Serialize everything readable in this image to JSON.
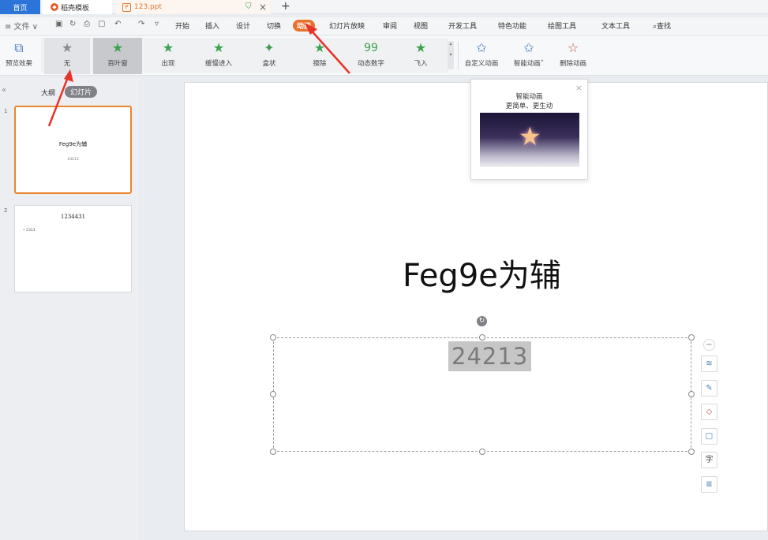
{
  "tabs": {
    "home": "首页",
    "template": "稻壳模板",
    "file": "123.ppt",
    "close": "×",
    "add": "+"
  },
  "quick_access": {
    "menu": "≡ 文件 ∨",
    "icons": [
      "save-icon",
      "undo-icon",
      "print-icon",
      "preview-icon",
      "redo-icon"
    ]
  },
  "menu": {
    "items": [
      "开始",
      "插入",
      "设计",
      "切换",
      "动画",
      "幻灯片放映",
      "审阅",
      "视图",
      "开发工具",
      "特色功能",
      "绘图工具",
      "文本工具"
    ],
    "active": "动画",
    "search": "查找"
  },
  "ribbon": {
    "preview": "预览效果",
    "effects": [
      "无",
      "百叶窗",
      "出现",
      "缓慢进入",
      "盒状",
      "擦除",
      "动态数字",
      "飞入"
    ],
    "custom": "自定义动画",
    "smart": "智能动画",
    "delete": "删除动画"
  },
  "panel": {
    "outline": "大纲",
    "slides": "幻灯片",
    "thumb1_num": "1",
    "thumb1_title": "Feg9e为辅",
    "thumb1_sub": "24213",
    "thumb2_num": "2",
    "thumb2_title": "1234431",
    "thumb2_bullet": "• 2313"
  },
  "slide": {
    "title": "Feg9e为辅",
    "subtitle": "24213"
  },
  "popup": {
    "line1": "智能动画",
    "line2": "更简单、更生动"
  },
  "side_tools": {
    "text_label": "字"
  },
  "colors": {
    "accent_orange": "#e8712d",
    "tab_blue": "#2d74d9",
    "annotation_red": "#e8332a"
  }
}
